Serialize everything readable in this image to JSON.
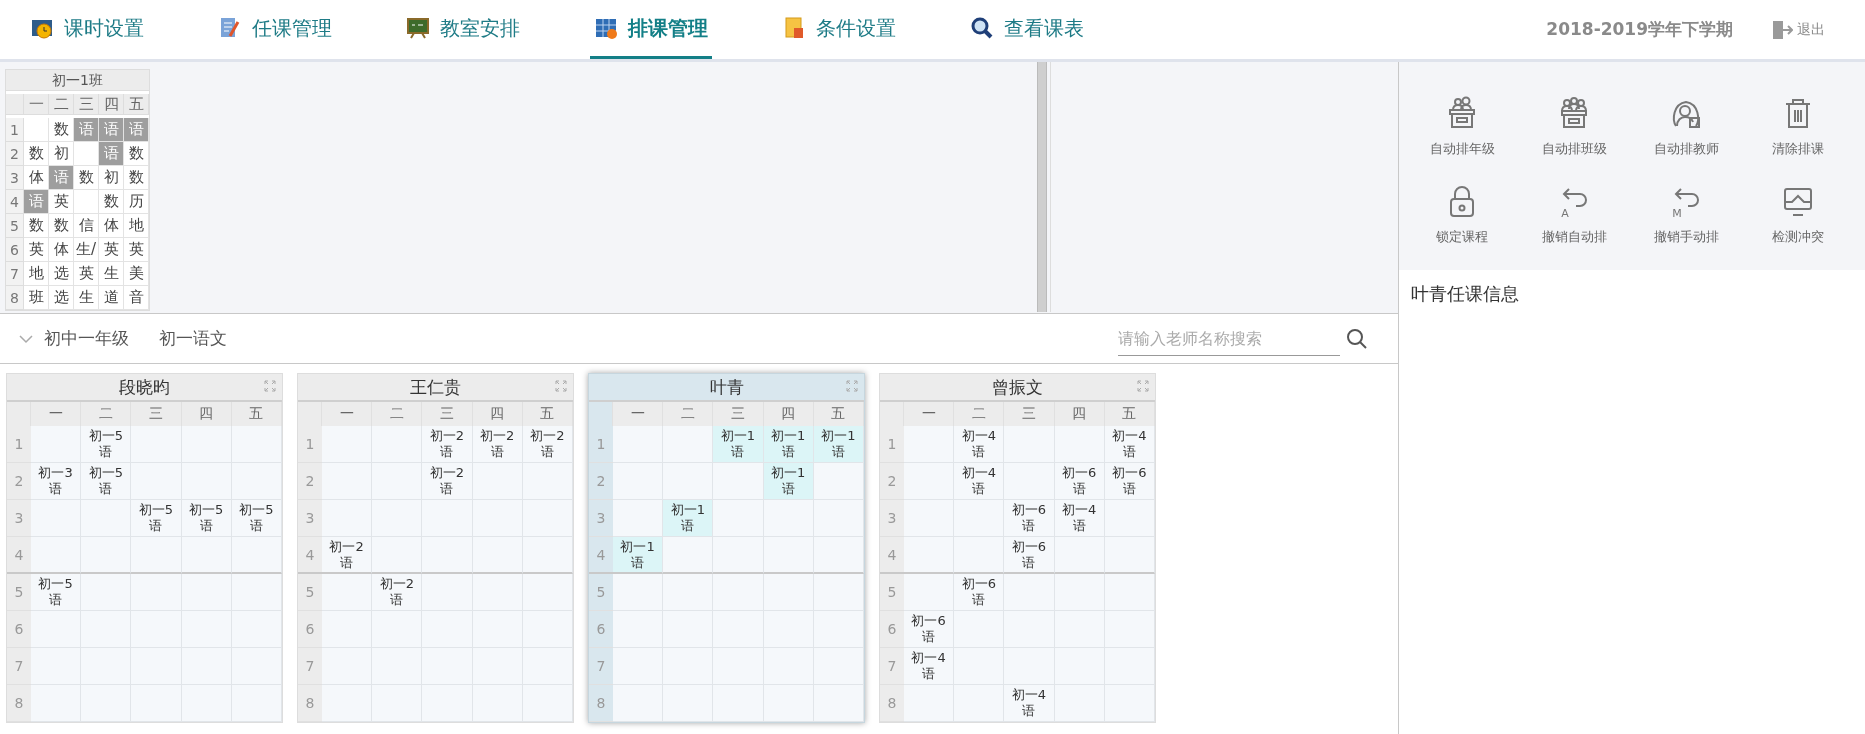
{
  "nav": {
    "tabs": [
      {
        "label": "课时设置",
        "selected": false
      },
      {
        "label": "任课管理",
        "selected": false
      },
      {
        "label": "教室安排",
        "selected": false
      },
      {
        "label": "排课管理",
        "selected": true
      },
      {
        "label": "条件设置",
        "selected": false
      },
      {
        "label": "查看课表",
        "selected": false
      }
    ],
    "term": "2018-2019学年下学期",
    "logout": "退出"
  },
  "class_timetable": {
    "title": "初一1班",
    "days": [
      "一",
      "二",
      "三",
      "四",
      "五"
    ],
    "rows": [
      {
        "period": "1",
        "cells": [
          null,
          {
            "text": "数",
            "highlighted": false
          },
          {
            "text": "语",
            "highlighted": true
          },
          {
            "text": "语",
            "highlighted": true
          },
          {
            "text": "语",
            "highlighted": true
          }
        ]
      },
      {
        "period": "2",
        "cells": [
          {
            "text": "数",
            "highlighted": false
          },
          {
            "text": "初",
            "highlighted": false
          },
          null,
          {
            "text": "语",
            "highlighted": true
          },
          {
            "text": "数",
            "highlighted": false
          }
        ]
      },
      {
        "period": "3",
        "cells": [
          {
            "text": "体",
            "highlighted": false
          },
          {
            "text": "语",
            "highlighted": true
          },
          {
            "text": "数",
            "highlighted": false
          },
          {
            "text": "初",
            "highlighted": false
          },
          {
            "text": "数",
            "highlighted": false
          }
        ]
      },
      {
        "period": "4",
        "cells": [
          {
            "text": "语",
            "highlighted": true
          },
          {
            "text": "英",
            "highlighted": false
          },
          null,
          {
            "text": "数",
            "highlighted": false
          },
          {
            "text": "历",
            "highlighted": false
          }
        ]
      },
      {
        "period": "5",
        "cells": [
          {
            "text": "数",
            "highlighted": false
          },
          {
            "text": "数",
            "highlighted": false
          },
          {
            "text": "信",
            "highlighted": false
          },
          {
            "text": "体",
            "highlighted": false
          },
          {
            "text": "地",
            "highlighted": false
          }
        ]
      },
      {
        "period": "6",
        "cells": [
          {
            "text": "英",
            "highlighted": false
          },
          {
            "text": "体",
            "highlighted": false
          },
          {
            "text": "生/",
            "highlighted": false
          },
          {
            "text": "英",
            "highlighted": false
          },
          {
            "text": "英",
            "highlighted": false
          }
        ]
      },
      {
        "period": "7",
        "cells": [
          {
            "text": "地",
            "highlighted": false
          },
          {
            "text": "选",
            "highlighted": false
          },
          {
            "text": "英",
            "highlighted": false
          },
          {
            "text": "生",
            "highlighted": false
          },
          {
            "text": "美",
            "highlighted": false
          }
        ]
      },
      {
        "period": "8",
        "cells": [
          {
            "text": "班",
            "highlighted": false
          },
          {
            "text": "选",
            "highlighted": false
          },
          {
            "text": "生",
            "highlighted": false
          },
          {
            "text": "道",
            "highlighted": false
          },
          {
            "text": "音",
            "highlighted": false
          }
        ]
      }
    ]
  },
  "filter": {
    "grade": "初中一年级",
    "subject": "初一语文",
    "search": {
      "placeholder": "请输入老师名称搜索"
    }
  },
  "teachers": [
    {
      "name": "段晓昀",
      "selected": false,
      "days": [
        "一",
        "二",
        "三",
        "四",
        "五"
      ],
      "periods": [
        "1",
        "2",
        "3",
        "4",
        "5",
        "6",
        "7",
        "8"
      ],
      "rows": [
        [
          null,
          {
            "class": "初一5",
            "subject": "语"
          },
          null,
          null,
          null
        ],
        [
          {
            "class": "初一3",
            "subject": "语"
          },
          {
            "class": "初一5",
            "subject": "语"
          },
          null,
          null,
          null
        ],
        [
          null,
          null,
          {
            "class": "初一5",
            "subject": "语"
          },
          {
            "class": "初一5",
            "subject": "语"
          },
          {
            "class": "初一5",
            "subject": "语"
          }
        ],
        [
          null,
          null,
          null,
          null,
          null
        ],
        [
          {
            "class": "初一5",
            "subject": "语"
          },
          null,
          null,
          null,
          null
        ],
        [
          null,
          null,
          null,
          null,
          null
        ],
        [
          null,
          null,
          null,
          null,
          null
        ],
        [
          null,
          null,
          null,
          null,
          null
        ]
      ]
    },
    {
      "name": "王仁贵",
      "selected": false,
      "days": [
        "一",
        "二",
        "三",
        "四",
        "五"
      ],
      "periods": [
        "1",
        "2",
        "3",
        "4",
        "5",
        "6",
        "7",
        "8"
      ],
      "rows": [
        [
          null,
          null,
          {
            "class": "初一2",
            "subject": "语"
          },
          {
            "class": "初一2",
            "subject": "语"
          },
          {
            "class": "初一2",
            "subject": "语"
          }
        ],
        [
          null,
          null,
          {
            "class": "初一2",
            "subject": "语"
          },
          null,
          null
        ],
        [
          null,
          null,
          null,
          null,
          null
        ],
        [
          {
            "class": "初一2",
            "subject": "语"
          },
          null,
          null,
          null,
          null
        ],
        [
          null,
          {
            "class": "初一2",
            "subject": "语"
          },
          null,
          null,
          null
        ],
        [
          null,
          null,
          null,
          null,
          null
        ],
        [
          null,
          null,
          null,
          null,
          null
        ],
        [
          null,
          null,
          null,
          null,
          null
        ]
      ]
    },
    {
      "name": "叶青",
      "selected": true,
      "days": [
        "一",
        "二",
        "三",
        "四",
        "五"
      ],
      "periods": [
        "1",
        "2",
        "3",
        "4",
        "5",
        "6",
        "7",
        "8"
      ],
      "rows": [
        [
          null,
          null,
          {
            "class": "初一1",
            "subject": "语"
          },
          {
            "class": "初一1",
            "subject": "语"
          },
          {
            "class": "初一1",
            "subject": "语"
          }
        ],
        [
          null,
          null,
          null,
          {
            "class": "初一1",
            "subject": "语"
          },
          null
        ],
        [
          null,
          {
            "class": "初一1",
            "subject": "语"
          },
          null,
          null,
          null
        ],
        [
          {
            "class": "初一1",
            "subject": "语"
          },
          null,
          null,
          null,
          null
        ],
        [
          null,
          null,
          null,
          null,
          null
        ],
        [
          null,
          null,
          null,
          null,
          null
        ],
        [
          null,
          null,
          null,
          null,
          null
        ],
        [
          null,
          null,
          null,
          null,
          null
        ]
      ]
    },
    {
      "name": "曾振文",
      "selected": false,
      "days": [
        "一",
        "二",
        "三",
        "四",
        "五"
      ],
      "periods": [
        "1",
        "2",
        "3",
        "4",
        "5",
        "6",
        "7",
        "8"
      ],
      "rows": [
        [
          null,
          {
            "class": "初一4",
            "subject": "语"
          },
          null,
          null,
          {
            "class": "初一4",
            "subject": "语"
          }
        ],
        [
          null,
          {
            "class": "初一4",
            "subject": "语"
          },
          null,
          {
            "class": "初一6",
            "subject": "语"
          },
          {
            "class": "初一6",
            "subject": "语"
          }
        ],
        [
          null,
          null,
          {
            "class": "初一6",
            "subject": "语"
          },
          {
            "class": "初一4",
            "subject": "语"
          },
          null
        ],
        [
          null,
          null,
          {
            "class": "初一6",
            "subject": "语"
          },
          null,
          null
        ],
        [
          null,
          {
            "class": "初一6",
            "subject": "语"
          },
          null,
          null,
          null
        ],
        [
          {
            "class": "初一6",
            "subject": "语"
          },
          null,
          null,
          null,
          null
        ],
        [
          {
            "class": "初一4",
            "subject": "语"
          },
          null,
          null,
          null,
          null
        ],
        [
          null,
          null,
          {
            "class": "初一4",
            "subject": "语"
          },
          null,
          null
        ]
      ]
    }
  ],
  "tools": [
    {
      "label": "自动排年级"
    },
    {
      "label": "自动排班级"
    },
    {
      "label": "自动排教师"
    },
    {
      "label": "清除排课"
    },
    {
      "label": "锁定课程"
    },
    {
      "label": "撤销自动排",
      "icon_text": "A"
    },
    {
      "label": "撤销手动排",
      "icon_text": "M"
    },
    {
      "label": "检测冲突"
    }
  ],
  "info": {
    "title": "叶青任课信息"
  }
}
